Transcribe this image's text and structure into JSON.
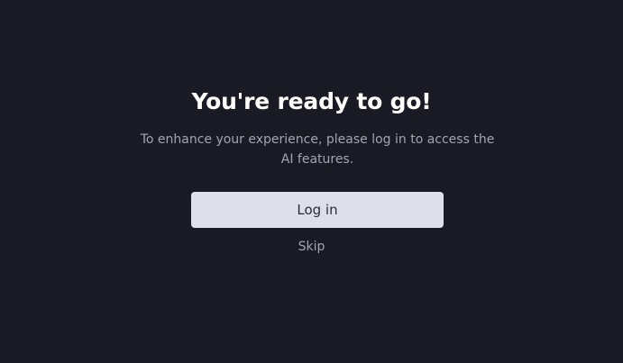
{
  "onboarding": {
    "title": "You're ready to go!",
    "subtitle": "To enhance your experience, please log in to access the AI features.",
    "login_label": "Log in",
    "skip_label": "Skip"
  },
  "colors": {
    "background": "#191a24",
    "title": "#ffffff",
    "muted_text": "#a2a5b4",
    "button_bg": "#dde0e9",
    "button_text": "#2a2b36"
  }
}
